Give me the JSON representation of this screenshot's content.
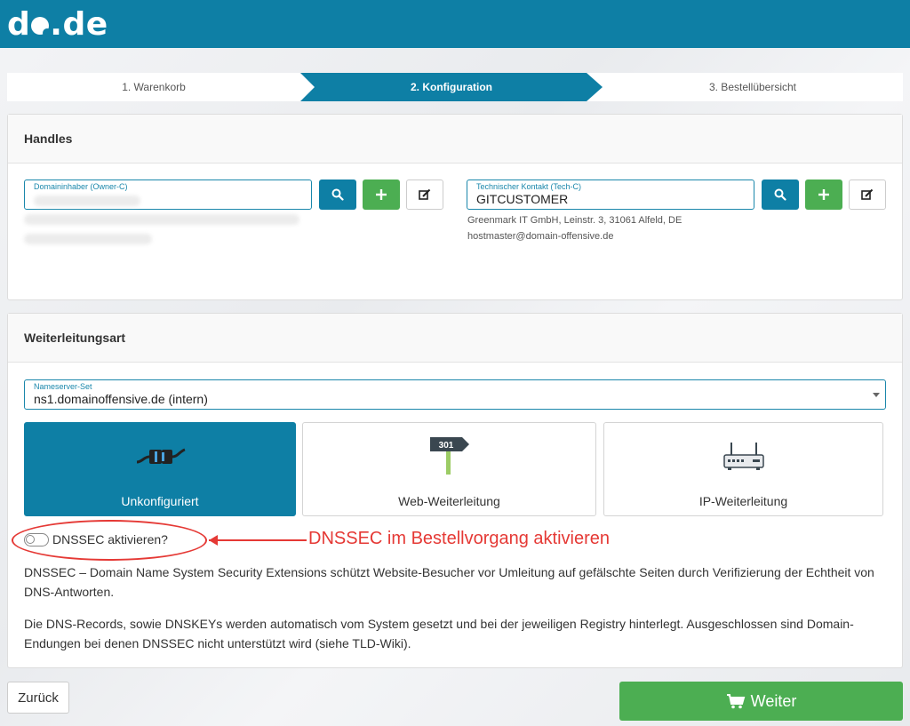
{
  "brand": {
    "logo": "do.de"
  },
  "steps": [
    {
      "label": "1. Warenkorb"
    },
    {
      "label": "2. Konfiguration"
    },
    {
      "label": "3. Bestellübersicht"
    }
  ],
  "handles": {
    "title": "Handles",
    "owner": {
      "label": "Domaininhaber (Owner-C)",
      "value": ""
    },
    "tech": {
      "label": "Technischer Kontakt (Tech-C)",
      "value": "GITCUSTOMER",
      "address": "Greenmark IT GmbH, Leinstr. 3, 31061 Alfeld, DE",
      "email": "hostmaster@domain-offensive.de"
    },
    "icons": {
      "search": "search-icon",
      "add": "plus-icon",
      "edit": "edit-icon"
    }
  },
  "forwarding": {
    "title": "Weiterleitungsart",
    "nameserver": {
      "label": "Nameserver-Set",
      "value": "ns1.domainoffensive.de (intern)"
    },
    "options": [
      {
        "label": "Unkonfiguriert",
        "icon": "plug-icon",
        "active": true
      },
      {
        "label": "Web-Weiterleitung",
        "icon": "signpost-301-icon",
        "active": false
      },
      {
        "label": "IP-Weiterleitung",
        "icon": "router-icon",
        "active": false
      }
    ],
    "signpost_text": "301",
    "dnssec_label": "DNSSEC aktivieren?",
    "annotation": "DNSSEC im Bestellvorgang aktivieren",
    "desc1": "DNSSEC – Domain Name System Security Extensions schützt Website-Besucher vor Umleitung auf gefälschte Seiten durch Verifizierung der Echtheit von DNS-Antworten.",
    "desc2": "Die DNS-Records, sowie DNSKEYs werden automatisch vom System gesetzt und bei der jeweiligen Registry hinterlegt. Ausgeschlossen sind Domain-Endungen bei denen DNSSEC nicht unterstützt wird (siehe TLD-Wiki)."
  },
  "footer": {
    "back": "Zurück",
    "next": "Weiter"
  },
  "colors": {
    "primary": "#0e7fa5",
    "success": "#4cae52",
    "annotation": "#e53935"
  }
}
